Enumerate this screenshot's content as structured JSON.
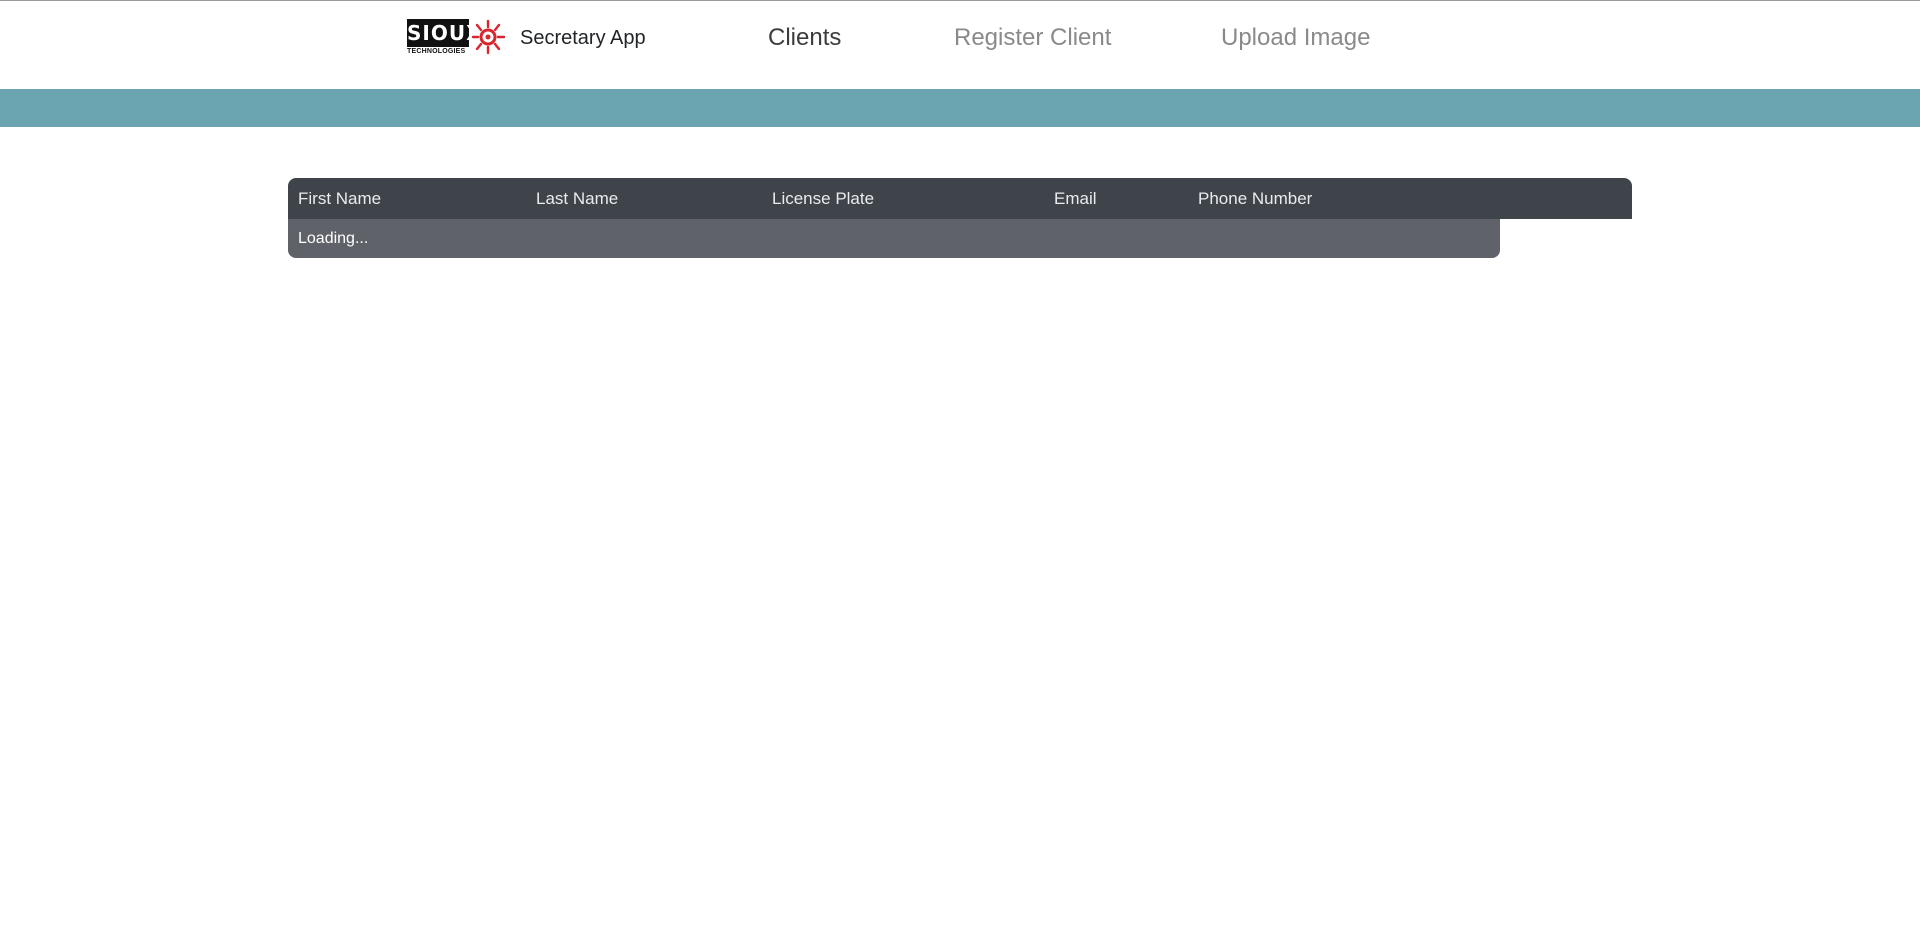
{
  "brand": {
    "logo_text": "SIOUX",
    "logo_subtext": "TECHNOLOGIES",
    "title": "Secretary App"
  },
  "nav": {
    "items": [
      {
        "label": "Clients",
        "active": true
      },
      {
        "label": "Register Client",
        "active": false
      },
      {
        "label": "Upload Image",
        "active": false
      }
    ]
  },
  "colors": {
    "banner": "#6ba5b2",
    "table_header": "#3f434a",
    "table_body": "#5f6369",
    "logo_accent": "#d9262e"
  },
  "table": {
    "columns": [
      "First Name",
      "Last Name",
      "License Plate",
      "Email",
      "Phone Number"
    ],
    "status": "Loading..."
  }
}
